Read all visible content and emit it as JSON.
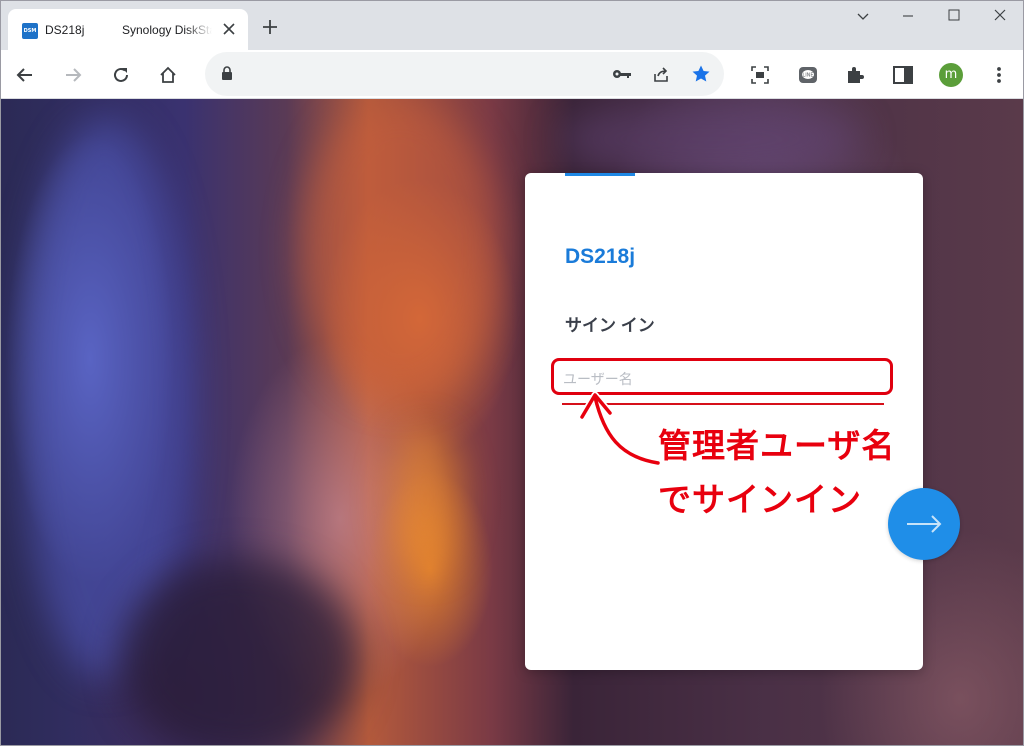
{
  "browser": {
    "tab": {
      "title": "DS218j",
      "secondary_title": "Synology DiskStation",
      "favicon_text": "DSM"
    },
    "omnibox": {
      "url": ""
    },
    "profile_initial": "m",
    "icons": [
      "back-icon",
      "forward-icon",
      "reload-icon",
      "home-icon",
      "lock-icon",
      "key-icon",
      "share-icon",
      "star-icon",
      "screenshot-icon",
      "line-icon",
      "extensions-icon",
      "sidepanel-icon",
      "menu-icon"
    ]
  },
  "login": {
    "hostname": "DS218j",
    "heading": "サイン イン",
    "username_placeholder": "ユーザー名",
    "username_value": ""
  },
  "annotation": {
    "line1": "管理者ユーザ名",
    "line2": "でサインイン",
    "color": "#e8000e"
  },
  "colors": {
    "accent": "#1a7bd9",
    "next_button": "#1f8ee8"
  }
}
